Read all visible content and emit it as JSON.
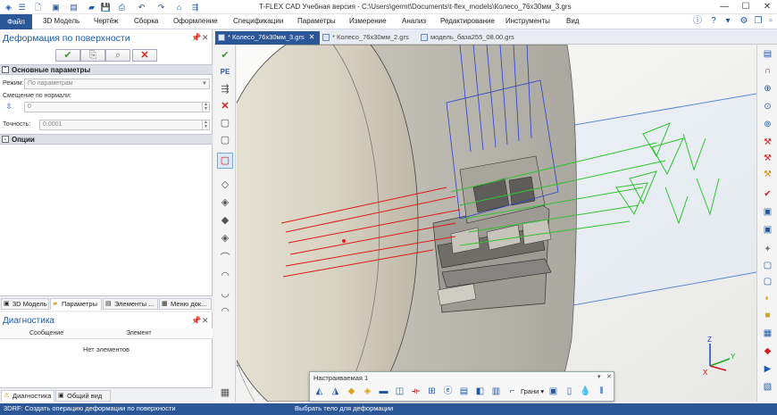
{
  "app": {
    "title": "T-FLEX CAD Учебная версия - C:\\Users\\germt\\Documents\\t-flex_models\\Колесо_76x30мм_3.grs"
  },
  "menu": {
    "file": "Файл",
    "items": [
      "3D Модель",
      "Чертёж",
      "Сборка",
      "Оформление",
      "Спецификации",
      "Параметры",
      "Измерение",
      "Анализ",
      "Редактирование",
      "Инструменты",
      "Вид"
    ]
  },
  "left_panel": {
    "title": "Деформация по поверхности",
    "ok_icon": "check-icon",
    "cancel_icon": "red-x-icon",
    "section_main": "Основные параметры",
    "mode_label": "Режим:",
    "mode_value": "По параметрам",
    "offset_label": "Смещение по нормали:",
    "offset_value": "0",
    "precision_label": "Точность:",
    "precision_value": "0.0001",
    "section_options": "Опции",
    "tabs": [
      "3D Модель",
      "Параметры",
      "Элементы ...",
      "Меню док..."
    ]
  },
  "diagnostics": {
    "title": "Диагностика",
    "col_message": "Сообщение",
    "col_element": "Элемент",
    "empty_text": "Нет элементов",
    "tabs": [
      "Диагностика",
      "Общий вид"
    ]
  },
  "documents": {
    "tabs": [
      "* Колесо_76x30мм_3.grs",
      "* Колесо_76x30мм_2.grs",
      "модель_база255_08.00.grs"
    ]
  },
  "custom_toolbar": {
    "title": "Настраиваемая 1",
    "dropdown_label": "Грани"
  },
  "status": {
    "command": "3DRF: Создать операцию деформации по поверхности",
    "prompt": "Выбрать тело для деформации"
  },
  "colors": {
    "accent": "#2b5797",
    "ok_green": "#3c9c2e",
    "cancel_red": "#d02020"
  },
  "viewport": {
    "axis_labels": [
      "Z",
      "Y",
      "X"
    ]
  }
}
